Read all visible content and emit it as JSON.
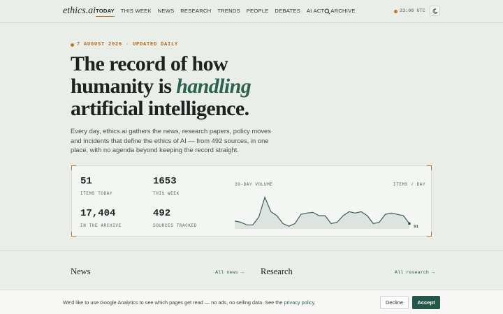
{
  "nav": {
    "logo": "ethics.ai",
    "items": [
      {
        "label": "TODAY",
        "active": true
      },
      {
        "label": "THIS WEEK"
      },
      {
        "label": "NEWS"
      },
      {
        "label": "RESEARCH"
      },
      {
        "label": "TRENDS"
      },
      {
        "label": "PEOPLE"
      },
      {
        "label": "DEBATES"
      },
      {
        "label": "AI ACT"
      },
      {
        "label": "ARCHIVE"
      }
    ],
    "clock": "23:08 UTC"
  },
  "hero": {
    "date_line": "7 AUGUST 2026 · UPDATED DAILY",
    "headline_1": "The record of how",
    "headline_2a": "humanity is ",
    "headline_2b": "handling",
    "headline_3": "artificial intelligence.",
    "intro": "Every day, ethics.ai gathers the news, research papers, policy moves and incidents that define the ethics of AI — from 492 sources, in one place, with no agenda beyond keeping the record straight."
  },
  "stats": [
    {
      "value": "51",
      "label": "ITEMS TODAY"
    },
    {
      "value": "1653",
      "label": "THIS WEEK"
    },
    {
      "value": "17,404",
      "label": "IN THE ARCHIVE"
    },
    {
      "value": "492",
      "label": "SOURCES TRACKED"
    }
  ],
  "chart_data": {
    "type": "area",
    "title": "30-DAY VOLUME",
    "unit_label": "ITEMS / DAY",
    "last_label": "51",
    "values": [
      52,
      50,
      46,
      46,
      58,
      88,
      66,
      60,
      48,
      44,
      48,
      62,
      64,
      65,
      60,
      60,
      48,
      50,
      60,
      66,
      64,
      66,
      60,
      48,
      50,
      62,
      64,
      62,
      60,
      48
    ],
    "ylim": [
      40,
      95
    ],
    "colors": {
      "line": "#3e5e55",
      "fill": "#dde4df",
      "endpoint": "#2b4a40"
    }
  },
  "sections": {
    "news_title": "News",
    "news_link": "All news →",
    "research_title": "Research",
    "research_link": "All research →"
  },
  "cookie": {
    "text": "We'd like to use Google Analytics to see which pages get read — no ads, no selling data. See the ",
    "link": "privacy policy",
    "text_end": ".",
    "decline": "Decline",
    "accept": "Accept"
  },
  "colors": {
    "accent": "#b5651d",
    "brand_green": "#2b6251",
    "accept_bg": "#24574a"
  }
}
